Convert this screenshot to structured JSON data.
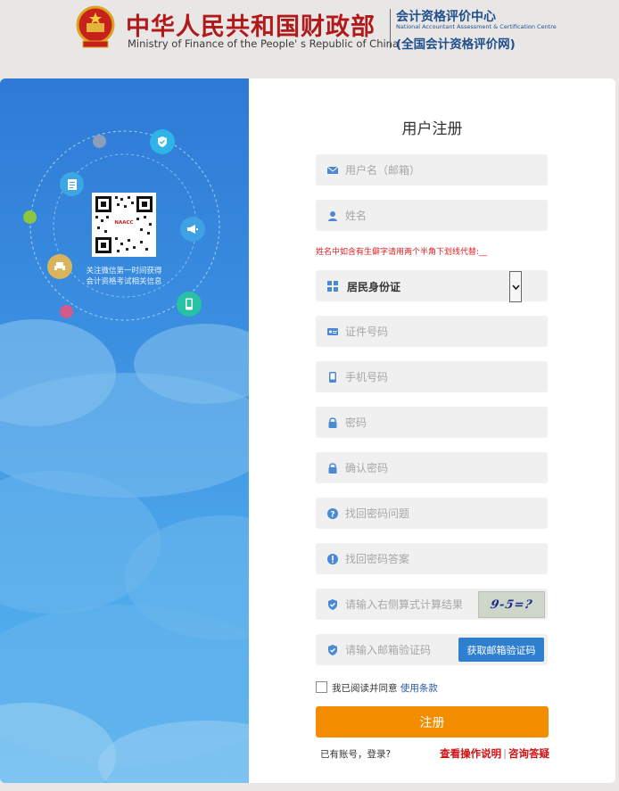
{
  "header": {
    "title_cn": "中华人民共和国财政部",
    "title_en": "Ministry of Finance of the People' s Republic of China",
    "org_cn": "会计资格评价中心",
    "org_en": "National Accountant Assessment & Certification Centre",
    "org_site": "(全国会计资格评价网)"
  },
  "sidebar": {
    "qr_label": "NAACC",
    "caption_line1": "关注微信第一时间获得",
    "caption_line2": "会计资格考试相关信息"
  },
  "form": {
    "title": "用户注册",
    "username_placeholder": "用户名（邮箱）",
    "name_placeholder": "姓名",
    "name_hint": "姓名中如含有生僻字请用两个半角下划线代替:__",
    "id_type_selected": "居民身份证",
    "id_number_placeholder": "证件号码",
    "phone_placeholder": "手机号码",
    "password_placeholder": "密码",
    "confirm_password_placeholder": "确认密码",
    "question_placeholder": "找回密码问题",
    "answer_placeholder": "找回密码答案",
    "captcha_placeholder": "请输入右侧算式计算结果",
    "captcha_text": "9-5=?",
    "email_code_placeholder": "请输入邮箱验证码",
    "get_code_label": "获取邮箱验证码",
    "agree_prefix": "我已阅读并同意",
    "agree_link": "使用条款",
    "submit_label": "注册",
    "login_text": "已有账号，登录?",
    "help_guide": "查看操作说明",
    "help_faq": "咨询答疑"
  },
  "colors": {
    "accent": "#f48c00",
    "brand_red": "#b01a1a",
    "brand_blue": "#1f4f8c",
    "button_blue": "#2f7fd1"
  }
}
